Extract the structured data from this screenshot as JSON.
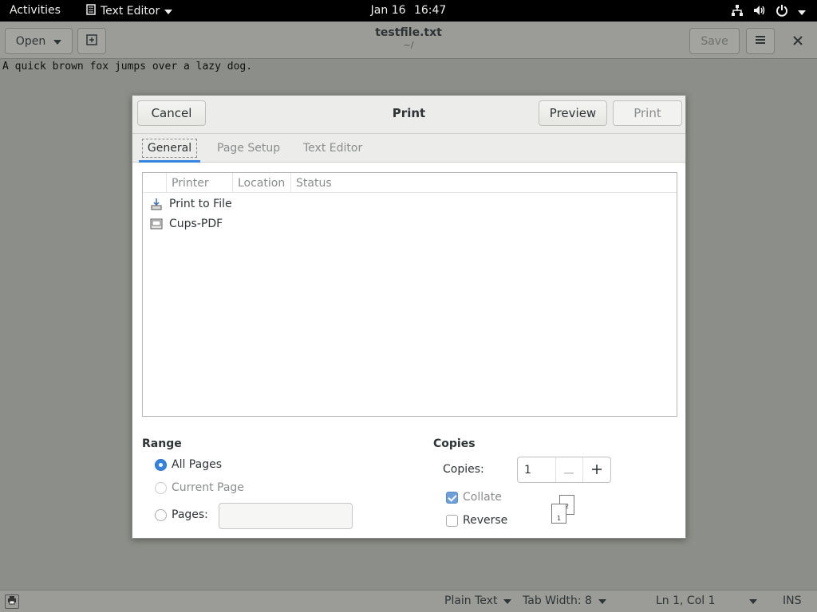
{
  "topbar": {
    "activities": "Activities",
    "app_name": "Text Editor",
    "date": "Jan 16",
    "time": "16:47",
    "icons": [
      "network-icon",
      "volume-icon",
      "power-icon",
      "chevron-down-icon"
    ]
  },
  "window": {
    "open_label": "Open",
    "title": "testfile.txt",
    "path": "~/",
    "save_label": "Save",
    "content_line": "A quick brown fox jumps over a lazy dog."
  },
  "statusbar": {
    "language": "Plain Text",
    "tab_width": "Tab Width: 8",
    "position": "Ln 1, Col 1",
    "mode": "INS"
  },
  "dialog": {
    "title": "Print",
    "cancel_label": "Cancel",
    "preview_label": "Preview",
    "print_label": "Print",
    "tabs": [
      {
        "label": "General",
        "active": true
      },
      {
        "label": "Page Setup",
        "active": false
      },
      {
        "label": "Text Editor",
        "active": false
      }
    ],
    "printer_columns": [
      "Printer",
      "Location",
      "Status"
    ],
    "printers": [
      {
        "name": "Print to File",
        "icon": "print-to-file-icon"
      },
      {
        "name": "Cups-PDF",
        "icon": "printer-icon"
      }
    ],
    "range": {
      "title": "Range",
      "all_pages": "All Pages",
      "current_page": "Current Page",
      "pages": "Pages:",
      "pages_value": "",
      "selected": "All Pages"
    },
    "copies": {
      "title": "Copies",
      "copies_label": "Copies:",
      "copies_value": "1",
      "collate_label": "Collate",
      "collate_checked": true,
      "reverse_label": "Reverse",
      "reverse_checked": false,
      "sheet_top": "2",
      "sheet_bottom": "1"
    }
  },
  "colors": {
    "accent": "#3584e4",
    "topbar": "#000000"
  }
}
